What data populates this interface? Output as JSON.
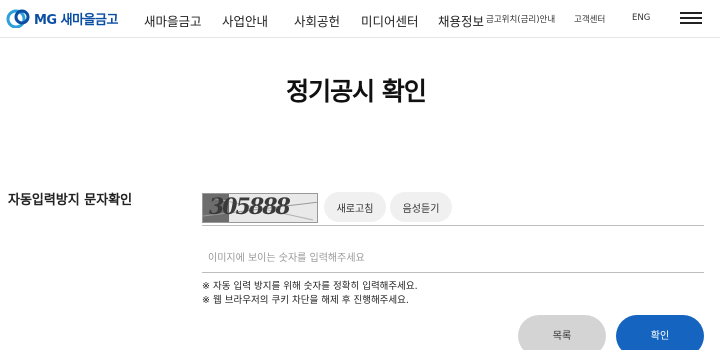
{
  "header": {
    "logo_text": "MG 새마을금고",
    "nav": [
      "새마을금고",
      "사업안내",
      "사회공헌",
      "미디어센터",
      "채용정보"
    ],
    "nav_small": [
      "금고위치(금리)안내",
      "고객센터",
      "ENG"
    ]
  },
  "page": {
    "title": "정기공시 확인"
  },
  "captcha": {
    "section_label": "자동입력방지 문자확인",
    "captcha_text": "305888",
    "refresh_label": "새로고침",
    "audio_label": "음성듣기",
    "input_placeholder": "이미지에 보이는 숫자를 입력해주세요",
    "notice_1": "※ 자동 입력 방지를 위해 숫자를 정확히 입력해주세요.",
    "notice_2": "※ 웹 브라우저의 쿠키 차단을 해제 후 진행해주세요."
  },
  "buttons": {
    "list_label": "목록",
    "confirm_label": "확인"
  },
  "colors": {
    "brand": "#0a4ea3",
    "confirm": "#1565c0",
    "list": "#d4d4d4"
  }
}
